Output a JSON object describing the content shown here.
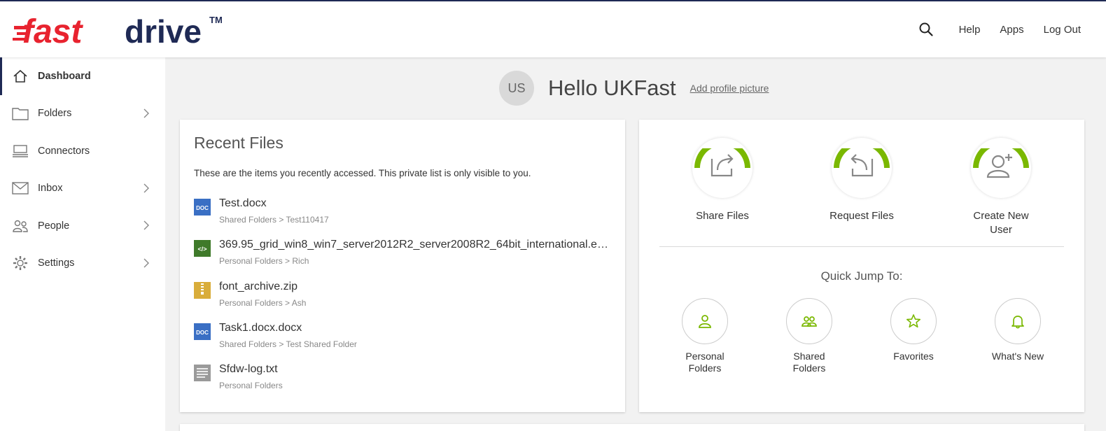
{
  "brand": {
    "logo_text_fast": "fast",
    "logo_text_drive": "drive",
    "trademark": "TM",
    "colors": {
      "red": "#e8232f",
      "navy": "#1f2a55",
      "green": "#7ab800"
    }
  },
  "header": {
    "search_icon": "search-icon",
    "links": [
      "Help",
      "Apps",
      "Log Out"
    ]
  },
  "sidebar": {
    "items": [
      {
        "label": "Dashboard",
        "icon": "home-icon",
        "active": true,
        "has_arrow": false
      },
      {
        "label": "Folders",
        "icon": "folder-icon",
        "active": false,
        "has_arrow": true
      },
      {
        "label": "Connectors",
        "icon": "connector-icon",
        "active": false,
        "has_arrow": false
      },
      {
        "label": "Inbox",
        "icon": "mail-icon",
        "active": false,
        "has_arrow": true
      },
      {
        "label": "People",
        "icon": "people-icon",
        "active": false,
        "has_arrow": true
      },
      {
        "label": "Settings",
        "icon": "gear-icon",
        "active": false,
        "has_arrow": true
      }
    ]
  },
  "profile": {
    "initials": "US",
    "greeting": "Hello UKFast",
    "add_picture": "Add profile picture"
  },
  "recent": {
    "title": "Recent Files",
    "description": "These are the items you recently accessed. This private list is only visible to you.",
    "files": [
      {
        "name": "Test.docx",
        "path": "Shared Folders  >  Test110417",
        "icon": "doc-icon",
        "badge": "DOC"
      },
      {
        "name": "369.95_grid_win8_win7_server2012R2_server2008R2_64bit_international.ex...",
        "path": "Personal Folders  >  Rich",
        "icon": "code-icon",
        "badge": "</>"
      },
      {
        "name": "font_archive.zip",
        "path": "Personal Folders  >  Ash",
        "icon": "zip-icon",
        "badge": ""
      },
      {
        "name": "Task1.docx.docx",
        "path": "Shared Folders  >  Test Shared Folder",
        "icon": "doc-icon",
        "badge": "DOC"
      },
      {
        "name": "Sfdw-log.txt",
        "path": "Personal Folders",
        "icon": "text-file-icon",
        "badge": ""
      }
    ]
  },
  "actions": {
    "items": [
      {
        "label": "Share Files",
        "icon": "share-icon"
      },
      {
        "label": "Request Files",
        "icon": "request-icon"
      },
      {
        "label": "Create New User",
        "icon": "add-user-icon"
      }
    ],
    "quick_jump_title": "Quick Jump To:",
    "quick_jump": [
      {
        "label": "Personal Folders",
        "icon": "person-icon"
      },
      {
        "label": "Shared Folders",
        "icon": "group-icon"
      },
      {
        "label": "Favorites",
        "icon": "star-icon"
      },
      {
        "label": "What's New",
        "icon": "bell-icon"
      }
    ]
  }
}
